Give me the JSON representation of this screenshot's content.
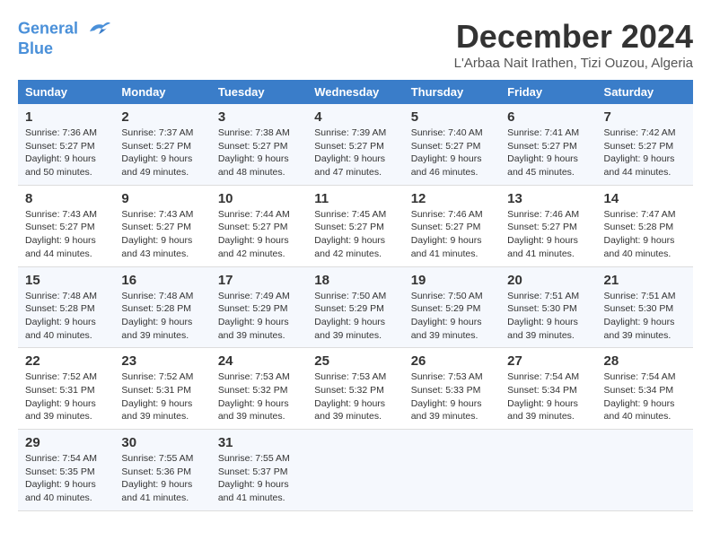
{
  "logo": {
    "line1": "General",
    "line2": "Blue"
  },
  "title": "December 2024",
  "location": "L'Arbaa Nait Irathen, Tizi Ouzou, Algeria",
  "headers": [
    "Sunday",
    "Monday",
    "Tuesday",
    "Wednesday",
    "Thursday",
    "Friday",
    "Saturday"
  ],
  "weeks": [
    [
      {
        "day": "1",
        "sunrise": "7:36 AM",
        "sunset": "5:27 PM",
        "daylight": "9 hours and 50 minutes."
      },
      {
        "day": "2",
        "sunrise": "7:37 AM",
        "sunset": "5:27 PM",
        "daylight": "9 hours and 49 minutes."
      },
      {
        "day": "3",
        "sunrise": "7:38 AM",
        "sunset": "5:27 PM",
        "daylight": "9 hours and 48 minutes."
      },
      {
        "day": "4",
        "sunrise": "7:39 AM",
        "sunset": "5:27 PM",
        "daylight": "9 hours and 47 minutes."
      },
      {
        "day": "5",
        "sunrise": "7:40 AM",
        "sunset": "5:27 PM",
        "daylight": "9 hours and 46 minutes."
      },
      {
        "day": "6",
        "sunrise": "7:41 AM",
        "sunset": "5:27 PM",
        "daylight": "9 hours and 45 minutes."
      },
      {
        "day": "7",
        "sunrise": "7:42 AM",
        "sunset": "5:27 PM",
        "daylight": "9 hours and 44 minutes."
      }
    ],
    [
      {
        "day": "8",
        "sunrise": "7:43 AM",
        "sunset": "5:27 PM",
        "daylight": "9 hours and 44 minutes."
      },
      {
        "day": "9",
        "sunrise": "7:43 AM",
        "sunset": "5:27 PM",
        "daylight": "9 hours and 43 minutes."
      },
      {
        "day": "10",
        "sunrise": "7:44 AM",
        "sunset": "5:27 PM",
        "daylight": "9 hours and 42 minutes."
      },
      {
        "day": "11",
        "sunrise": "7:45 AM",
        "sunset": "5:27 PM",
        "daylight": "9 hours and 42 minutes."
      },
      {
        "day": "12",
        "sunrise": "7:46 AM",
        "sunset": "5:27 PM",
        "daylight": "9 hours and 41 minutes."
      },
      {
        "day": "13",
        "sunrise": "7:46 AM",
        "sunset": "5:27 PM",
        "daylight": "9 hours and 41 minutes."
      },
      {
        "day": "14",
        "sunrise": "7:47 AM",
        "sunset": "5:28 PM",
        "daylight": "9 hours and 40 minutes."
      }
    ],
    [
      {
        "day": "15",
        "sunrise": "7:48 AM",
        "sunset": "5:28 PM",
        "daylight": "9 hours and 40 minutes."
      },
      {
        "day": "16",
        "sunrise": "7:48 AM",
        "sunset": "5:28 PM",
        "daylight": "9 hours and 39 minutes."
      },
      {
        "day": "17",
        "sunrise": "7:49 AM",
        "sunset": "5:29 PM",
        "daylight": "9 hours and 39 minutes."
      },
      {
        "day": "18",
        "sunrise": "7:50 AM",
        "sunset": "5:29 PM",
        "daylight": "9 hours and 39 minutes."
      },
      {
        "day": "19",
        "sunrise": "7:50 AM",
        "sunset": "5:29 PM",
        "daylight": "9 hours and 39 minutes."
      },
      {
        "day": "20",
        "sunrise": "7:51 AM",
        "sunset": "5:30 PM",
        "daylight": "9 hours and 39 minutes."
      },
      {
        "day": "21",
        "sunrise": "7:51 AM",
        "sunset": "5:30 PM",
        "daylight": "9 hours and 39 minutes."
      }
    ],
    [
      {
        "day": "22",
        "sunrise": "7:52 AM",
        "sunset": "5:31 PM",
        "daylight": "9 hours and 39 minutes."
      },
      {
        "day": "23",
        "sunrise": "7:52 AM",
        "sunset": "5:31 PM",
        "daylight": "9 hours and 39 minutes."
      },
      {
        "day": "24",
        "sunrise": "7:53 AM",
        "sunset": "5:32 PM",
        "daylight": "9 hours and 39 minutes."
      },
      {
        "day": "25",
        "sunrise": "7:53 AM",
        "sunset": "5:32 PM",
        "daylight": "9 hours and 39 minutes."
      },
      {
        "day": "26",
        "sunrise": "7:53 AM",
        "sunset": "5:33 PM",
        "daylight": "9 hours and 39 minutes."
      },
      {
        "day": "27",
        "sunrise": "7:54 AM",
        "sunset": "5:34 PM",
        "daylight": "9 hours and 39 minutes."
      },
      {
        "day": "28",
        "sunrise": "7:54 AM",
        "sunset": "5:34 PM",
        "daylight": "9 hours and 40 minutes."
      }
    ],
    [
      {
        "day": "29",
        "sunrise": "7:54 AM",
        "sunset": "5:35 PM",
        "daylight": "9 hours and 40 minutes."
      },
      {
        "day": "30",
        "sunrise": "7:55 AM",
        "sunset": "5:36 PM",
        "daylight": "9 hours and 41 minutes."
      },
      {
        "day": "31",
        "sunrise": "7:55 AM",
        "sunset": "5:37 PM",
        "daylight": "9 hours and 41 minutes."
      },
      null,
      null,
      null,
      null
    ]
  ],
  "labels": {
    "sunrise": "Sunrise:",
    "sunset": "Sunset:",
    "daylight": "Daylight:"
  }
}
